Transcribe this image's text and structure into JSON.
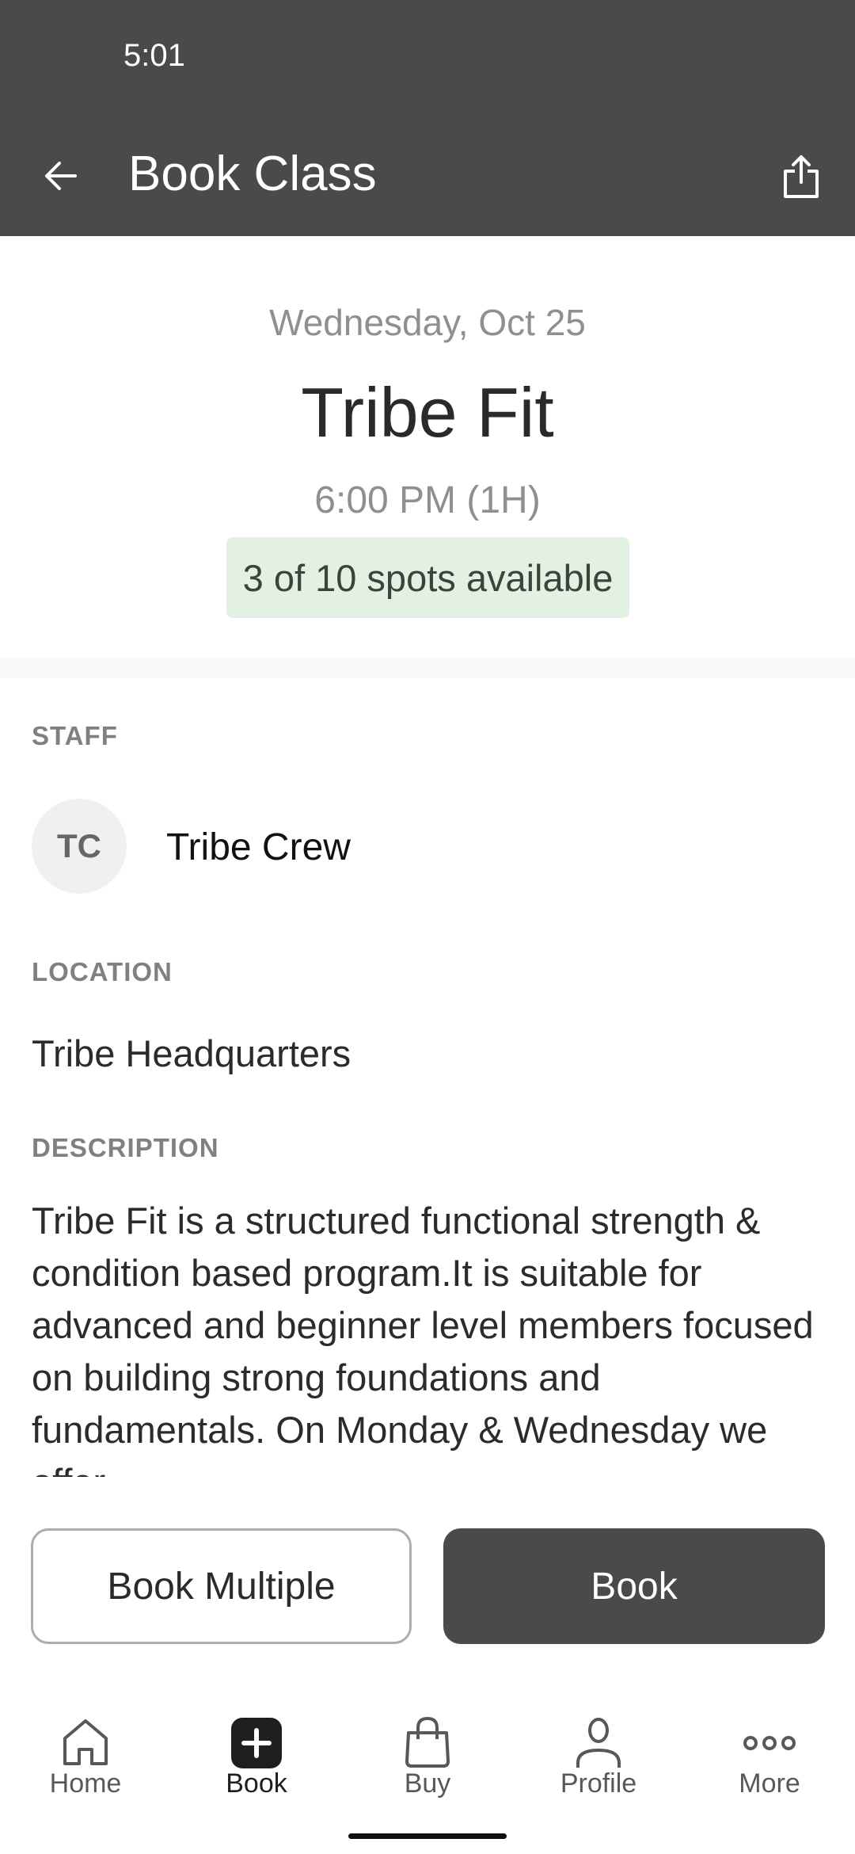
{
  "status_bar": {
    "time": "5:01"
  },
  "header": {
    "title": "Book Class",
    "back_icon": "arrow-left-icon",
    "share_icon": "share-icon"
  },
  "class": {
    "date": "Wednesday, Oct 25",
    "name": "Tribe Fit",
    "time": "6:00 PM (1H)",
    "availability": "3 of 10 spots available",
    "spots_available": 3,
    "spots_total": 10
  },
  "staff": {
    "label": "STAFF",
    "initials": "TC",
    "name": "Tribe Crew"
  },
  "location": {
    "label": "LOCATION",
    "name": "Tribe Headquarters"
  },
  "description": {
    "label": "DESCRIPTION",
    "text": "Tribe Fit is a structured functional strength & condition based program.It is suitable for advanced and beginner level members focused on building strong foundations and fundamentals. On Monday & Wednesday we offer"
  },
  "actions": {
    "book_multiple_label": "Book Multiple",
    "book_label": "Book"
  },
  "nav": {
    "items": [
      {
        "label": "Home",
        "icon": "home-icon",
        "active": false
      },
      {
        "label": "Book",
        "icon": "plus-square-icon",
        "active": true
      },
      {
        "label": "Buy",
        "icon": "shopping-bag-icon",
        "active": false
      },
      {
        "label": "Profile",
        "icon": "person-icon",
        "active": false
      },
      {
        "label": "More",
        "icon": "more-dots-icon",
        "active": false
      }
    ]
  },
  "colors": {
    "header_bg": "#4a494c",
    "badge_bg": "#e3f1e3",
    "primary_button": "#4a494c"
  }
}
